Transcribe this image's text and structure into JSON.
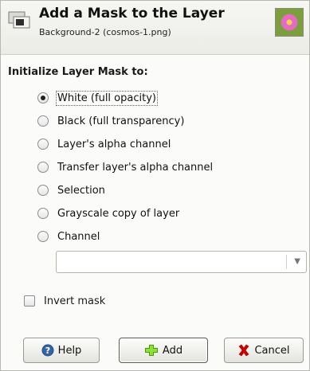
{
  "dialog": {
    "title": "Add a Mask to the Layer",
    "subtitle": "Background-2 (cosmos-1.png)",
    "section_label": "Initialize Layer Mask to:",
    "options": [
      {
        "label": "White (full opacity)",
        "checked": true
      },
      {
        "label": "Black (full transparency)",
        "checked": false
      },
      {
        "label": "Layer's alpha channel",
        "checked": false
      },
      {
        "label": "Transfer layer's alpha channel",
        "checked": false
      },
      {
        "label": "Selection",
        "checked": false
      },
      {
        "label": "Grayscale copy of layer",
        "checked": false
      },
      {
        "label": "Channel",
        "checked": false
      }
    ],
    "channel_combo_value": "",
    "invert_mask_label": "Invert mask",
    "invert_mask_checked": false,
    "buttons": {
      "help": "Help",
      "add": "Add",
      "cancel": "Cancel"
    },
    "icons": {
      "header": "mask-layer-icon",
      "help": "help-icon",
      "add": "add-plus-icon",
      "cancel": "cancel-x-icon",
      "thumbnail": "layer-thumbnail-image"
    },
    "colors": {
      "add_icon": "#4e9a06",
      "help_icon": "#3465a4",
      "cancel_icon": "#cc0000"
    }
  }
}
